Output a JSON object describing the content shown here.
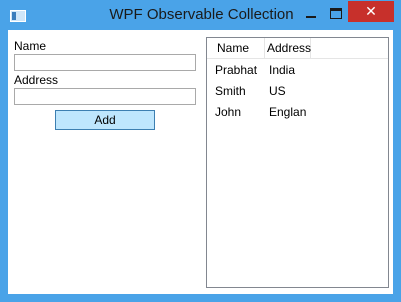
{
  "window": {
    "title": "WPF Observable Collection",
    "close_glyph": "✕",
    "icon": "app-window-icon"
  },
  "form": {
    "name_label": "Name",
    "name_value": "",
    "address_label": "Address",
    "address_value": "",
    "add_button_label": "Add"
  },
  "listview": {
    "columns": [
      "Name",
      "Address"
    ],
    "rows": [
      {
        "name": "Prabhat",
        "address": "India"
      },
      {
        "name": "Smith",
        "address": "US"
      },
      {
        "name": "John",
        "address": "Englan"
      }
    ]
  },
  "colors": {
    "titlebar": "#4aa3e8",
    "close_button": "#c7302b",
    "add_button_fill": "#bee6fd",
    "add_button_border": "#3c7fb1"
  }
}
